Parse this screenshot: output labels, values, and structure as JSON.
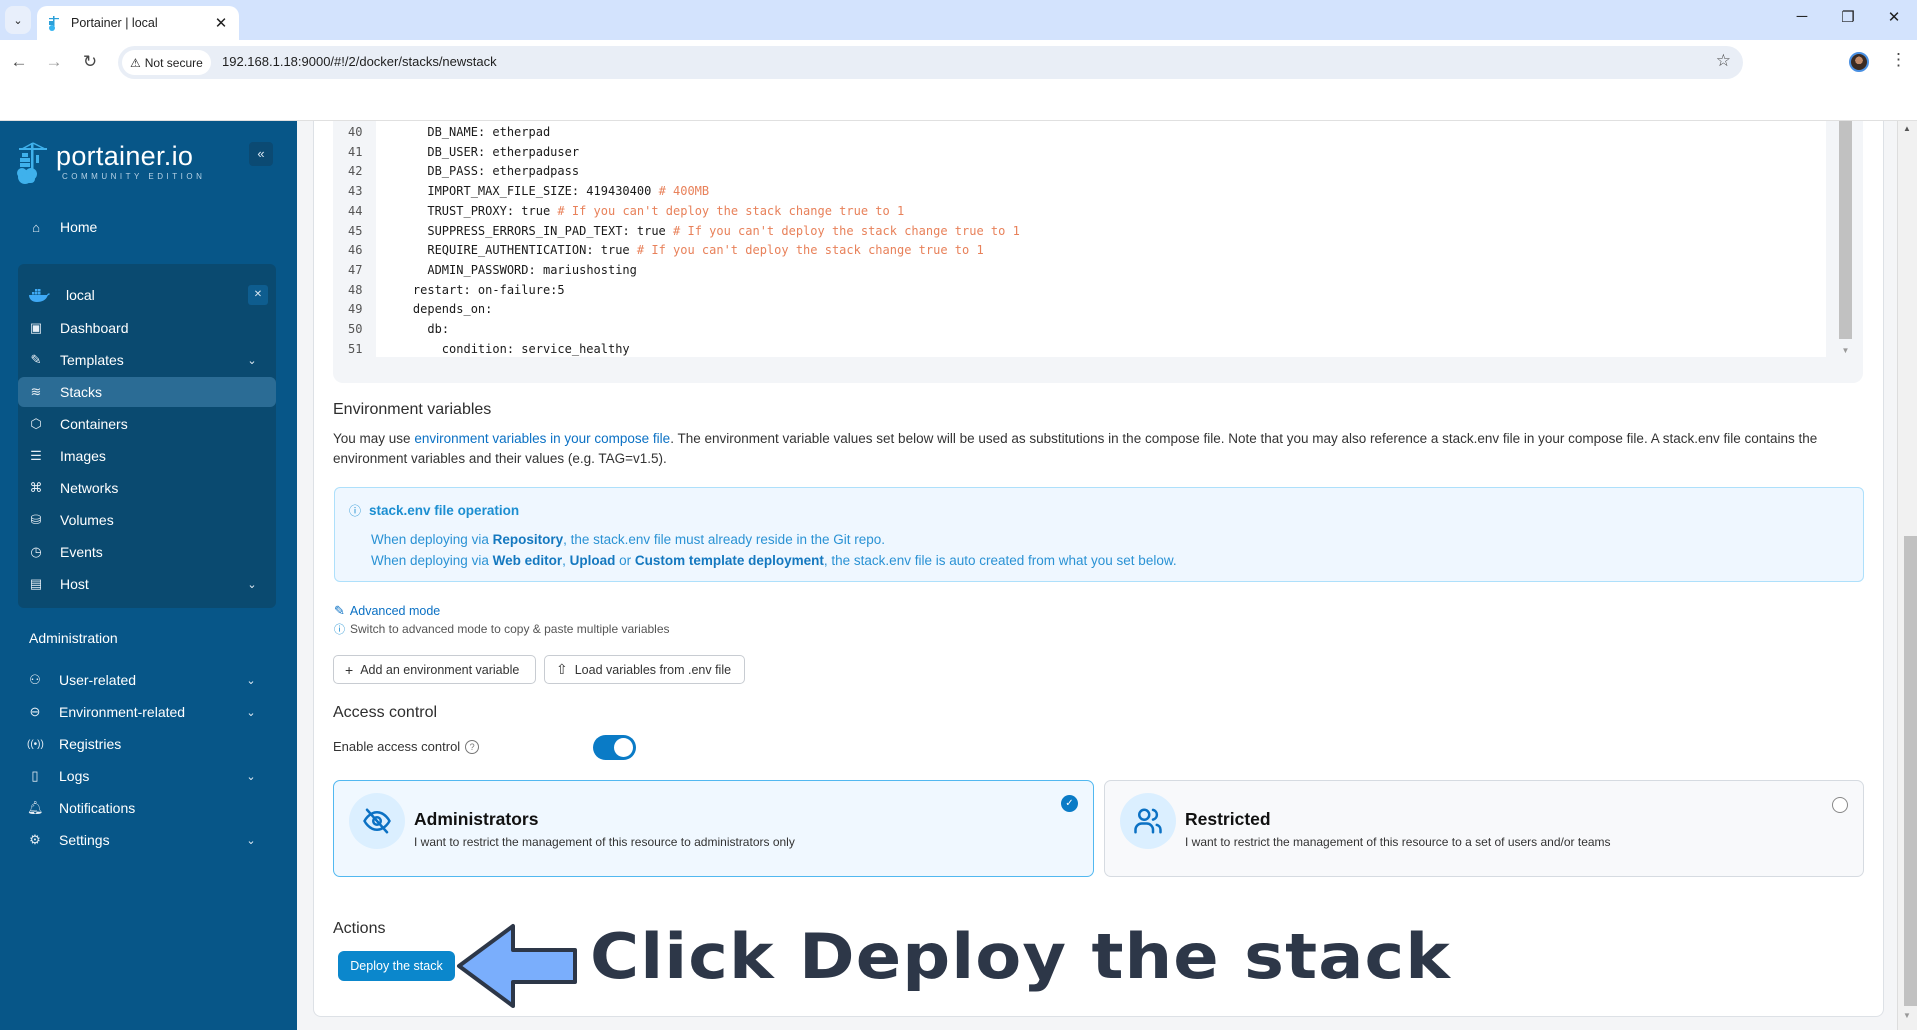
{
  "browser": {
    "tab_title": "Portainer | local",
    "security_label": "Not secure",
    "url": "192.168.1.18:9000/#!/2/docker/stacks/newstack",
    "icons": {
      "tab_list": "chevron-down-icon",
      "close_tab": "close-icon",
      "back": "arrow-left-icon",
      "forward": "arrow-right-icon",
      "reload": "reload-icon",
      "warning": "warning-icon",
      "bookmark": "star-icon",
      "minimize": "minimize-icon",
      "restore": "restore-icon",
      "close_window": "close-icon",
      "menu": "kebab-menu-icon"
    }
  },
  "sidebar": {
    "brand": "portainer.io",
    "edition": "COMMUNITY EDITION",
    "collapse_icon": "«",
    "home_label": "Home",
    "environment": {
      "name": "local",
      "items": [
        {
          "label": "Dashboard",
          "icon": "dashboard-icon",
          "expandable": false,
          "active": false
        },
        {
          "label": "Templates",
          "icon": "edit-icon",
          "expandable": true,
          "active": false
        },
        {
          "label": "Stacks",
          "icon": "layers-icon",
          "expandable": false,
          "active": true
        },
        {
          "label": "Containers",
          "icon": "box-icon",
          "expandable": false,
          "active": false
        },
        {
          "label": "Images",
          "icon": "list-icon",
          "expandable": false,
          "active": false
        },
        {
          "label": "Networks",
          "icon": "network-icon",
          "expandable": false,
          "active": false
        },
        {
          "label": "Volumes",
          "icon": "database-icon",
          "expandable": false,
          "active": false
        },
        {
          "label": "Events",
          "icon": "clock-icon",
          "expandable": false,
          "active": false
        },
        {
          "label": "Host",
          "icon": "host-icon",
          "expandable": true,
          "active": false
        }
      ]
    },
    "admin_title": "Administration",
    "admin_items": [
      {
        "label": "User-related",
        "icon": "users-icon",
        "expandable": true
      },
      {
        "label": "Environment-related",
        "icon": "server-icon",
        "expandable": true
      },
      {
        "label": "Registries",
        "icon": "radio-icon",
        "expandable": false
      },
      {
        "label": "Logs",
        "icon": "file-icon",
        "expandable": true
      },
      {
        "label": "Notifications",
        "icon": "bell-icon",
        "expandable": false
      },
      {
        "label": "Settings",
        "icon": "gear-icon",
        "expandable": true
      }
    ]
  },
  "editor": {
    "lines": [
      {
        "no": "40",
        "indent": "      ",
        "key": "DB_NAME",
        "value": ": etherpad",
        "comment": ""
      },
      {
        "no": "41",
        "indent": "      ",
        "key": "DB_USER",
        "value": ": etherpaduser",
        "comment": ""
      },
      {
        "no": "42",
        "indent": "      ",
        "key": "DB_PASS",
        "value": ": etherpadpass",
        "comment": ""
      },
      {
        "no": "43",
        "indent": "      ",
        "key": "IMPORT_MAX_FILE_SIZE",
        "value": ": 419430400 ",
        "comment": "# 400MB"
      },
      {
        "no": "44",
        "indent": "      ",
        "key": "TRUST_PROXY",
        "value": ": true ",
        "comment": "# If you can't deploy the stack change true to 1"
      },
      {
        "no": "45",
        "indent": "      ",
        "key": "SUPPRESS_ERRORS_IN_PAD_TEXT",
        "value": ": true ",
        "comment": "# If you can't deploy the stack change true to 1"
      },
      {
        "no": "46",
        "indent": "      ",
        "key": "REQUIRE_AUTHENTICATION",
        "value": ": true ",
        "comment": "# If you can't deploy the stack change true to 1"
      },
      {
        "no": "47",
        "indent": "      ",
        "key": "ADMIN_PASSWORD",
        "value": ": mariushosting",
        "comment": ""
      },
      {
        "no": "48",
        "indent": "    ",
        "key": "restart",
        "value": ": on-failure:5",
        "comment": ""
      },
      {
        "no": "49",
        "indent": "    ",
        "key": "depends_on",
        "value": ":",
        "comment": ""
      },
      {
        "no": "50",
        "indent": "      ",
        "key": "db",
        "value": ":",
        "comment": ""
      },
      {
        "no": "51",
        "indent": "        ",
        "key": "condition",
        "value": ": service_healthy",
        "comment": ""
      }
    ]
  },
  "env_vars": {
    "title": "Environment variables",
    "desc_prefix": "You may use ",
    "desc_link": "environment variables in your compose file",
    "desc_suffix": ". The environment variable values set below will be used as substitutions in the compose file. Note that you may also reference a stack.env file in your compose file. A stack.env file contains the environment variables and their values (e.g. TAG=v1.5).",
    "info": {
      "title": "stack.env file operation",
      "line1_a": "When deploying via ",
      "line1_b": "Repository",
      "line1_c": ", the stack.env file must already reside in the Git repo.",
      "line2_a": "When deploying via ",
      "line2_b": "Web editor",
      "line2_c": ", ",
      "line2_d": "Upload",
      "line2_e": " or ",
      "line2_f": "Custom template deployment",
      "line2_g": ", the stack.env file is auto created from what you set below."
    },
    "advanced_mode": "Advanced mode",
    "advanced_hint": "Switch to advanced mode to copy & paste multiple variables",
    "add_button": "Add an environment variable",
    "load_button": "Load variables from .env file"
  },
  "access_control": {
    "title": "Access control",
    "toggle_label": "Enable access control",
    "enabled": true,
    "options": [
      {
        "title": "Administrators",
        "desc": "I want to restrict the management of this resource to administrators only",
        "selected": true,
        "icon": "eye-off-icon"
      },
      {
        "title": "Restricted",
        "desc": "I want to restrict the management of this resource to a set of users and/or teams",
        "selected": false,
        "icon": "users-icon"
      }
    ]
  },
  "actions": {
    "title": "Actions",
    "deploy_button": "Deploy the stack"
  },
  "annotation": {
    "text": "Click Deploy the stack",
    "arrow_color": "#7aaefc"
  },
  "colors": {
    "sidebar_bg": "#075688",
    "accent": "#0b87cc",
    "comment": "#e8815a"
  }
}
